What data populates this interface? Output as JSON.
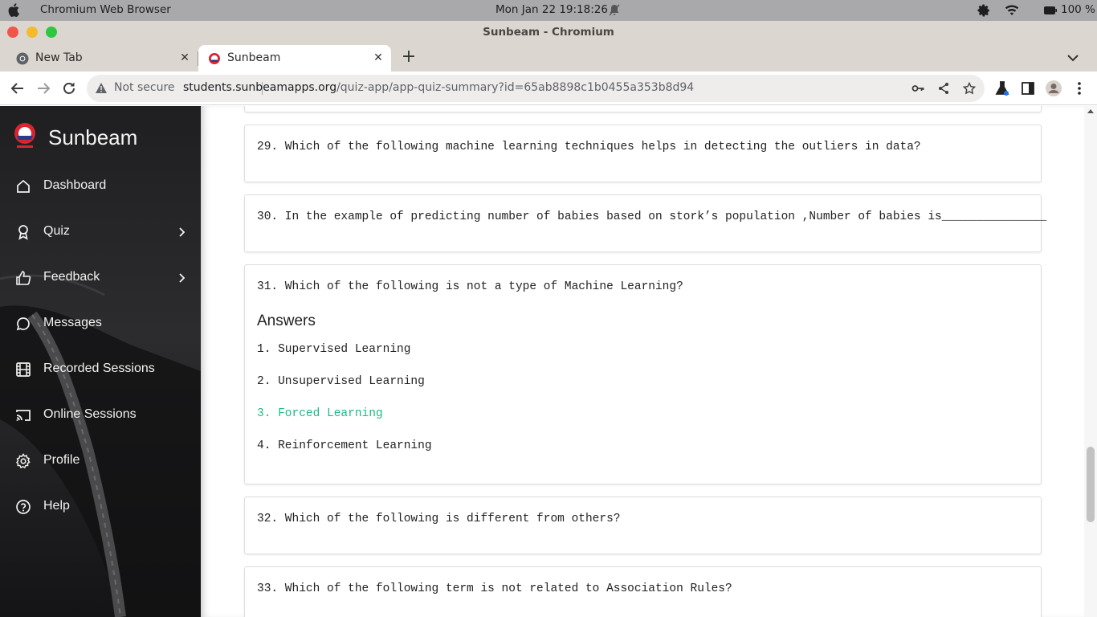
{
  "os_bar": {
    "app_name": "Chromium Web Browser",
    "clock": "Mon Jan 22  19:18:26",
    "battery": "100 %"
  },
  "window": {
    "title": "Sunbeam - Chromium"
  },
  "tabs": [
    {
      "label": "New Tab",
      "active": false
    },
    {
      "label": "Sunbeam",
      "active": true
    }
  ],
  "toolbar": {
    "security_label": "Not secure",
    "url_host": "students.sunbeamapps.org",
    "url_path": "/quiz-app/app-quiz-summary?id=65ab8898c1b0455a353b8d94"
  },
  "sidebar": {
    "brand": "Sunbeam",
    "items": [
      {
        "label": "Dashboard",
        "icon": "home-icon",
        "has_submenu": false
      },
      {
        "label": "Quiz",
        "icon": "award-icon",
        "has_submenu": true
      },
      {
        "label": "Feedback",
        "icon": "thumbs-up-icon",
        "has_submenu": true
      },
      {
        "label": "Messages",
        "icon": "message-icon",
        "has_submenu": false
      },
      {
        "label": "Recorded Sessions",
        "icon": "film-icon",
        "has_submenu": false
      },
      {
        "label": "Online Sessions",
        "icon": "cast-icon",
        "has_submenu": false
      },
      {
        "label": "Profile",
        "icon": "gear-icon",
        "has_submenu": false
      },
      {
        "label": "Help",
        "icon": "help-circle-icon",
        "has_submenu": false
      }
    ]
  },
  "questions": [
    {
      "text": "29. Which of the following machine learning techniques helps in detecting the outliers in data?"
    },
    {
      "text": "30. In the example of predicting number of babies based on stork’s population ,Number of babies is_______________"
    },
    {
      "text": "31. Which of the following is not a type of Machine Learning?",
      "answers_heading": "Answers",
      "answers": [
        {
          "text": "1. Supervised Learning",
          "correct": false
        },
        {
          "text": "2. Unsupervised Learning",
          "correct": false
        },
        {
          "text": "3. Forced Learning",
          "correct": true
        },
        {
          "text": "4. Reinforcement Learning",
          "correct": false
        }
      ]
    },
    {
      "text": "32. Which of the following is different from others?"
    },
    {
      "text": "33. Which of the following term is not related to Association Rules?"
    }
  ],
  "colors": {
    "correct_answer": "#20b883",
    "sidebar_bg": "#1d1d1f",
    "os_bar": "#a9a9ab",
    "tab_strip": "#dcd6d0"
  }
}
